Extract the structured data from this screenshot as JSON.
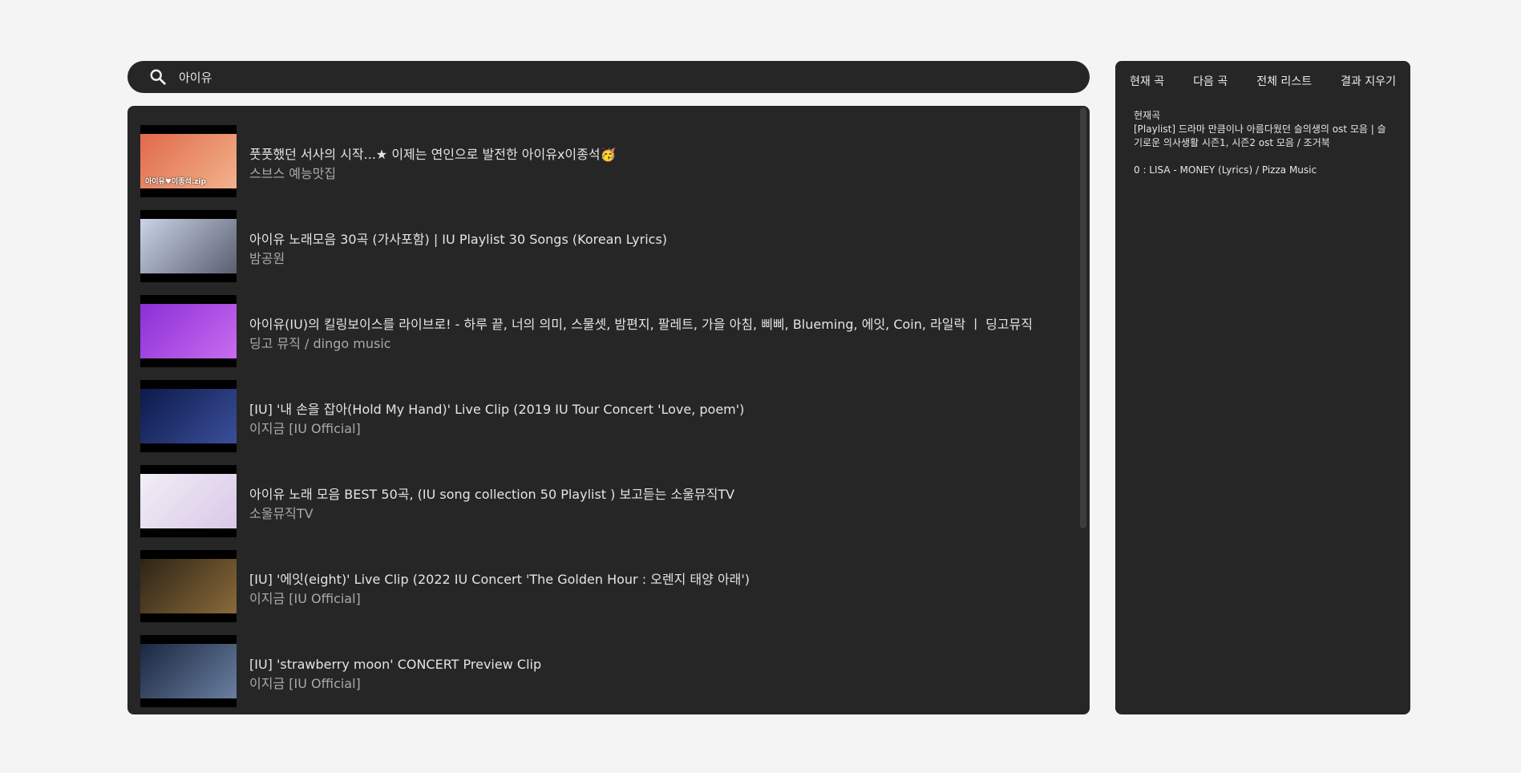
{
  "search": {
    "icon": "search-icon",
    "value": "아이유"
  },
  "results": [
    {
      "title": "풋풋했던 서사의 시작...★ 이제는 연인으로 발전한 아이유x이종석🥳",
      "channel": "스브스 예능맛집",
      "thumb_caption": "아이유♥이종석.zip",
      "thumb_colors": [
        "#e06a4a",
        "#f3b28c"
      ]
    },
    {
      "title": "아이유 노래모음 30곡 (가사포함) | IU Playlist 30 Songs (Korean Lyrics)",
      "channel": "밤공원",
      "thumb_caption": "",
      "thumb_colors": [
        "#c9d4e6",
        "#5a5f70"
      ]
    },
    {
      "title": "아이유(IU)의 킬링보이스를 라이브로! - 하루 끝, 너의 의미, 스물셋, 밤편지, 팔레트, 가을 아침, 삐삐, Blueming, 에잇, Coin, 라일락 ㅣ 딩고뮤직",
      "channel": "딩고 뮤직 / dingo music",
      "thumb_caption": "",
      "thumb_colors": [
        "#8b2fd6",
        "#c96cf0"
      ]
    },
    {
      "title": "[IU] '내 손을 잡아(Hold My Hand)' Live Clip (2019 IU Tour Concert 'Love, poem')",
      "channel": "이지금 [IU Official]",
      "thumb_caption": "",
      "thumb_colors": [
        "#0d1a4a",
        "#3a4f9a"
      ]
    },
    {
      "title": "아이유 노래 모음 BEST 50곡, (IU song collection 50 Playlist ) 보고듣는 소울뮤직TV",
      "channel": "소울뮤직TV",
      "thumb_caption": "",
      "thumb_colors": [
        "#f2eef5",
        "#d9c8e8"
      ]
    },
    {
      "title": "[IU] '에잇(eight)' Live Clip (2022 IU Concert 'The Golden Hour : 오렌지 태양 아래')",
      "channel": "이지금 [IU Official]",
      "thumb_caption": "",
      "thumb_colors": [
        "#2e2415",
        "#8a6a3a"
      ]
    },
    {
      "title": "[IU] 'strawberry moon' CONCERT Preview Clip",
      "channel": "이지금 [IU Official]",
      "thumb_caption": "",
      "thumb_colors": [
        "#1a2740",
        "#6a7fa0"
      ]
    }
  ],
  "side_panel": {
    "tabs": [
      "현재 곡",
      "다음 곡",
      "전체 리스트",
      "결과 지우기"
    ],
    "now_label": "현재곡",
    "now_playing": "[Playlist] 드라마 만큼이나 아름다웠던 슬의생의 ost 모음 | 슬기로운 의사생활 시즌1, 시즌2 ost 모음 / 조거북",
    "queue": [
      "0 : LISA - MONEY (Lyrics) / Pizza Music"
    ]
  }
}
